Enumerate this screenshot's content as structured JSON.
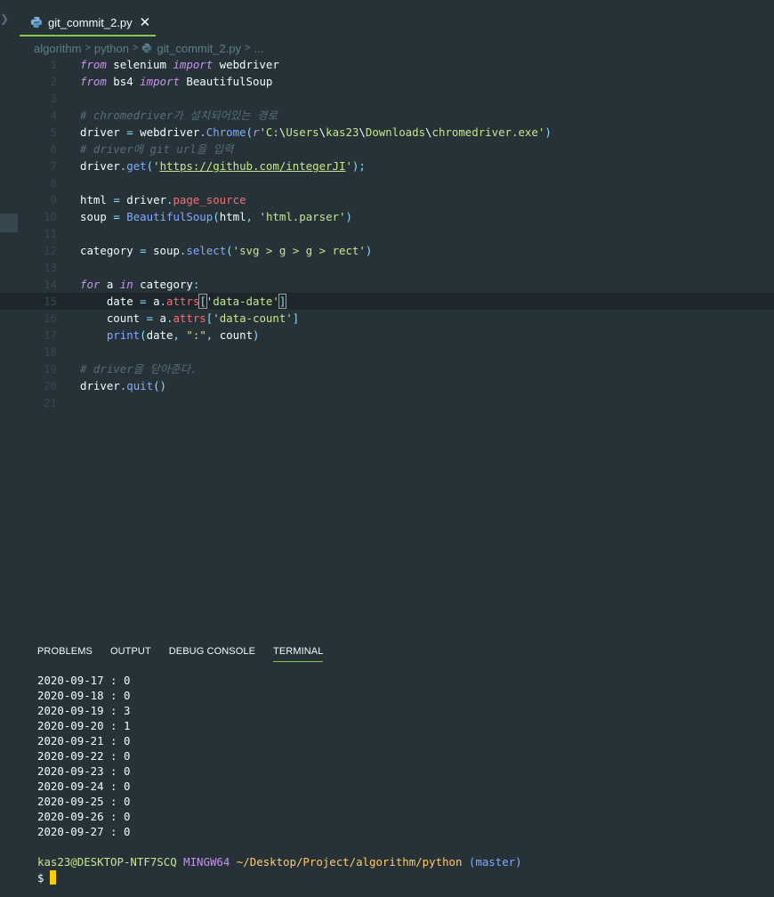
{
  "tab": {
    "label": "git_commit_2.py",
    "close": "✕"
  },
  "breadcrumb": [
    "algorithm",
    "python",
    "git_commit_2.py",
    "..."
  ],
  "code": [
    {
      "n": "1",
      "tokens": [
        [
          "kw",
          "from"
        ],
        [
          "plain",
          " selenium "
        ],
        [
          "kw",
          "import"
        ],
        [
          "plain",
          " webdriver"
        ]
      ]
    },
    {
      "n": "2",
      "tokens": [
        [
          "kw",
          "from"
        ],
        [
          "plain",
          " bs4 "
        ],
        [
          "kw",
          "import"
        ],
        [
          "plain",
          " BeautifulSoup"
        ]
      ]
    },
    {
      "n": "3",
      "tokens": []
    },
    {
      "n": "4",
      "tokens": [
        [
          "cm",
          "# chromedriver가 설치되어있는 경로"
        ]
      ]
    },
    {
      "n": "5",
      "tokens": [
        [
          "plain",
          "driver "
        ],
        [
          "punc",
          "="
        ],
        [
          "plain",
          " webdriver"
        ],
        [
          "punc",
          "."
        ],
        [
          "fn",
          "Chrome"
        ],
        [
          "punc",
          "("
        ],
        [
          "kw-plain",
          "r"
        ],
        [
          "str",
          "'C:"
        ],
        [
          "esc",
          "\\"
        ],
        [
          "str",
          "Users"
        ],
        [
          "esc",
          "\\"
        ],
        [
          "str",
          "kas23"
        ],
        [
          "esc",
          "\\"
        ],
        [
          "str",
          "Downloads"
        ],
        [
          "esc",
          "\\"
        ],
        [
          "str",
          "chromedriver.exe'"
        ],
        [
          "punc",
          ")"
        ]
      ]
    },
    {
      "n": "6",
      "tokens": [
        [
          "cm",
          "# driver에 git url을 입력"
        ]
      ]
    },
    {
      "n": "7",
      "tokens": [
        [
          "plain",
          "driver"
        ],
        [
          "punc",
          "."
        ],
        [
          "fn",
          "get"
        ],
        [
          "punc",
          "("
        ],
        [
          "str",
          "'"
        ],
        [
          "str url",
          "https://github.com/integerJI"
        ],
        [
          "str",
          "'"
        ],
        [
          "punc",
          ");"
        ]
      ]
    },
    {
      "n": "8",
      "tokens": []
    },
    {
      "n": "9",
      "tokens": [
        [
          "plain",
          "html "
        ],
        [
          "punc",
          "="
        ],
        [
          "plain",
          " driver"
        ],
        [
          "punc",
          "."
        ],
        [
          "prop",
          "page_source"
        ]
      ]
    },
    {
      "n": "10",
      "tokens": [
        [
          "plain",
          "soup "
        ],
        [
          "punc",
          "="
        ],
        [
          "plain",
          " "
        ],
        [
          "fn",
          "BeautifulSoup"
        ],
        [
          "punc",
          "("
        ],
        [
          "plain",
          "html"
        ],
        [
          "punc",
          ","
        ],
        [
          "plain",
          " "
        ],
        [
          "str",
          "'html.parser'"
        ],
        [
          "punc",
          ")"
        ]
      ]
    },
    {
      "n": "11",
      "tokens": []
    },
    {
      "n": "12",
      "tokens": [
        [
          "plain",
          "category "
        ],
        [
          "punc",
          "="
        ],
        [
          "plain",
          " soup"
        ],
        [
          "punc",
          "."
        ],
        [
          "fn",
          "select"
        ],
        [
          "punc",
          "("
        ],
        [
          "str",
          "'svg > g > g > rect'"
        ],
        [
          "punc",
          ")"
        ]
      ]
    },
    {
      "n": "13",
      "tokens": []
    },
    {
      "n": "14",
      "tokens": [
        [
          "kw",
          "for"
        ],
        [
          "plain",
          " a "
        ],
        [
          "kw",
          "in"
        ],
        [
          "plain",
          " category"
        ],
        [
          "punc",
          ":"
        ]
      ]
    },
    {
      "n": "15",
      "active": true,
      "tokens": [
        [
          "plain",
          "    date "
        ],
        [
          "punc",
          "="
        ],
        [
          "plain",
          " a"
        ],
        [
          "punc",
          "."
        ],
        [
          "prop",
          "attrs"
        ],
        [
          "punc hl",
          "["
        ],
        [
          "str",
          "'data-date'"
        ],
        [
          "punc hl",
          "]"
        ]
      ]
    },
    {
      "n": "16",
      "tokens": [
        [
          "plain",
          "    count "
        ],
        [
          "punc",
          "="
        ],
        [
          "plain",
          " a"
        ],
        [
          "punc",
          "."
        ],
        [
          "prop",
          "attrs"
        ],
        [
          "punc",
          "["
        ],
        [
          "str",
          "'data-count'"
        ],
        [
          "punc",
          "]"
        ]
      ]
    },
    {
      "n": "17",
      "tokens": [
        [
          "plain",
          "    "
        ],
        [
          "fn",
          "print"
        ],
        [
          "punc",
          "("
        ],
        [
          "plain",
          "date"
        ],
        [
          "punc",
          ","
        ],
        [
          "plain",
          " "
        ],
        [
          "str",
          "\":\""
        ],
        [
          "punc",
          ","
        ],
        [
          "plain",
          " count"
        ],
        [
          "punc",
          ")"
        ]
      ]
    },
    {
      "n": "18",
      "tokens": []
    },
    {
      "n": "19",
      "tokens": [
        [
          "cm",
          "# driver을 닫아준다."
        ]
      ]
    },
    {
      "n": "20",
      "tokens": [
        [
          "plain",
          "driver"
        ],
        [
          "punc",
          "."
        ],
        [
          "fn",
          "quit"
        ],
        [
          "punc",
          "()"
        ]
      ]
    },
    {
      "n": "21",
      "tokens": []
    }
  ],
  "panel": {
    "tabs": [
      "PROBLEMS",
      "OUTPUT",
      "DEBUG CONSOLE",
      "TERMINAL"
    ],
    "active": "TERMINAL"
  },
  "terminal": {
    "lines": [
      "2020-09-17 : 0",
      "2020-09-18 : 0",
      "2020-09-19 : 3",
      "2020-09-20 : 1",
      "2020-09-21 : 0",
      "2020-09-22 : 0",
      "2020-09-23 : 0",
      "2020-09-24 : 0",
      "2020-09-25 : 0",
      "2020-09-26 : 0",
      "2020-09-27 : 0"
    ],
    "prompt_user": "kas23@DESKTOP-NTF7SCQ",
    "prompt_system": "MINGW64",
    "prompt_path": "~/Desktop/Project/algorithm/python",
    "prompt_branch": "(master)",
    "dollar": "$"
  }
}
